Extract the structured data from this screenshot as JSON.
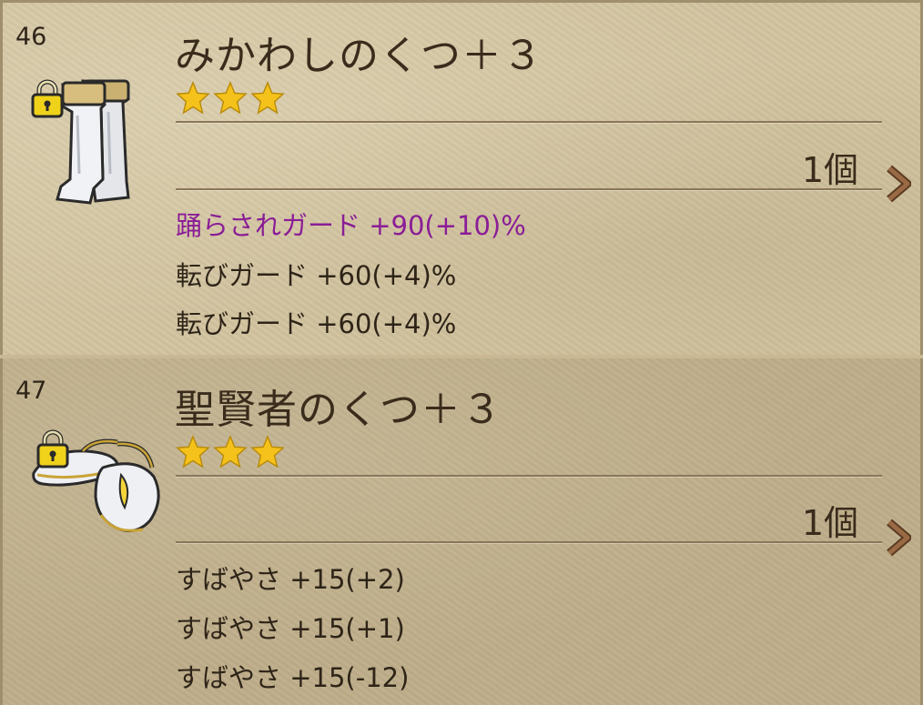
{
  "items": [
    {
      "number": "46",
      "name": "みかわしのくつ＋３",
      "stars": 3,
      "quantity": "1個",
      "icon": "boots-icon",
      "locked": true,
      "stats": [
        {
          "text": "踊らされガード +90(+10)%",
          "highlight": true
        },
        {
          "text": "転びガード +60(+4)%",
          "highlight": false
        },
        {
          "text": "転びガード +60(+4)%",
          "highlight": false
        }
      ]
    },
    {
      "number": "47",
      "name": "聖賢者のくつ＋３",
      "stars": 3,
      "quantity": "1個",
      "icon": "sandals-icon",
      "locked": true,
      "stats": [
        {
          "text": "すばやさ +15(+2)",
          "highlight": false
        },
        {
          "text": "すばやさ +15(+1)",
          "highlight": false
        },
        {
          "text": "すばやさ +15(-12)",
          "highlight": false
        }
      ]
    }
  ],
  "colors": {
    "highlight_stat": "#8a1d96",
    "star": "#f4c21b",
    "chevron": "#8a5a3a",
    "selected_row_bg": "#bfae8a",
    "row_bg": "#d3c4a0"
  }
}
